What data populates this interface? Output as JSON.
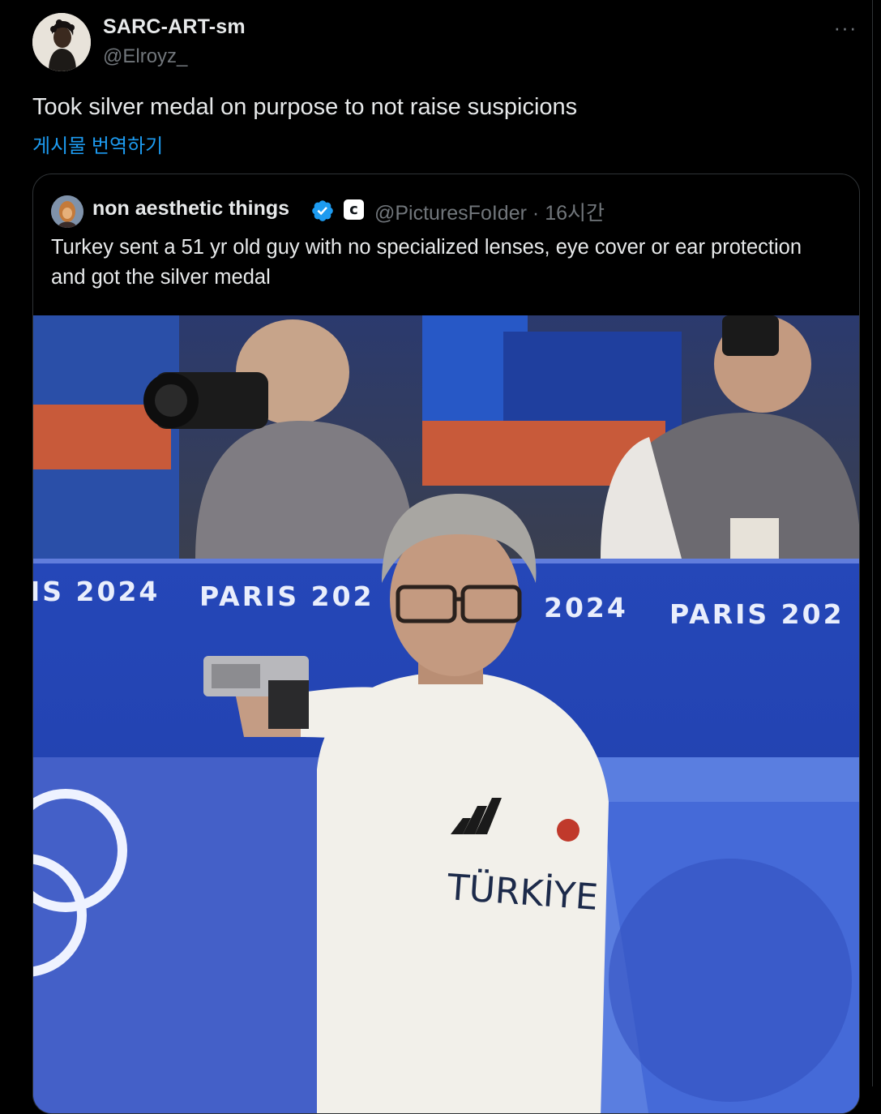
{
  "post": {
    "author": {
      "name": "SARC-ART-sm",
      "handle": "@Elroyz_"
    },
    "more_label": "···",
    "text": "Took silver medal on purpose to not raise suspicions",
    "translate_label": "게시물 번역하기"
  },
  "quote": {
    "author": {
      "name": "non aesthetic things",
      "handle": "@PicturesFoIder",
      "affiliate_badge": "c"
    },
    "separator": "·",
    "time": "16시간",
    "text": "Turkey sent a 51 yr old guy with no specialized lenses, eye cover or ear protection and got the silver medal",
    "media": {
      "banner_texts": [
        "IS 2024",
        "PARIS 202",
        "2024",
        "PARIS 202"
      ],
      "shirt_text": "TÜRKİYE"
    }
  },
  "colors": {
    "background": "#000000",
    "primary_text": "#e7e9ea",
    "secondary_text": "#71767b",
    "link": "#1d9bf0",
    "border": "#2f3336"
  },
  "icons": {
    "more": "more-horizontal-icon",
    "verified": "verified-badge-icon",
    "affiliate": "affiliate-badge-icon"
  }
}
